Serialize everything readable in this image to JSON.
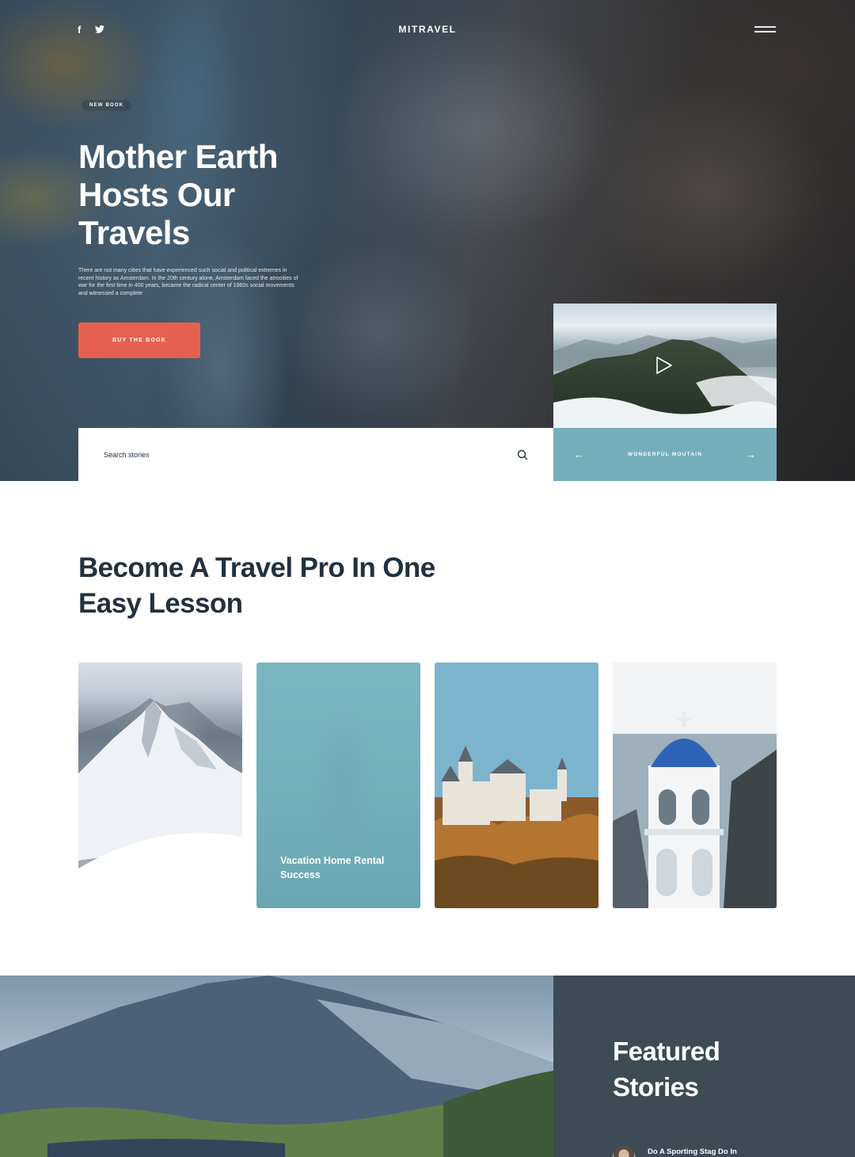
{
  "header": {
    "social": [
      {
        "name": "facebook",
        "glyph": "f"
      },
      {
        "name": "twitter",
        "glyph": "t"
      }
    ],
    "brand": "MITRAVEL",
    "menu_icon": "hamburger-icon"
  },
  "hero": {
    "tag": "NEW BOOK",
    "title": "Mother Earth Hosts Our Travels",
    "description": "There are not many cities that have experienced such social and political extremes in recent history as Amsterdam. In the 20th century alone, Amsterdam faced the atrocities of war for the first time in 400 years, became the radical center of 1960s social movements and witnessed a complete",
    "cta_label": "BUY THE BOOK",
    "search_placeholder": "Search stories",
    "slider_label": "WONDERFUL MOUTAIN",
    "colors": {
      "cta": "#e46152",
      "slider": "#75aebb"
    }
  },
  "lesson": {
    "title": "Become A Travel Pro In One Easy Lesson",
    "cards": [
      {
        "caption": ""
      },
      {
        "caption": "Vacation Home Rental Success"
      },
      {
        "caption": ""
      },
      {
        "caption": ""
      }
    ]
  },
  "featured": {
    "title": "Featured Stories",
    "story_title": "Do A Sporting Stag Do In",
    "panel_color": "#3c4b54"
  }
}
